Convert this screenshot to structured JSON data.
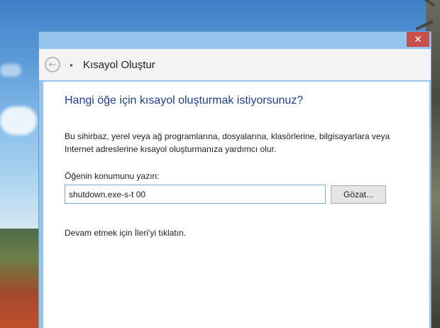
{
  "window": {
    "close_glyph": "✕",
    "nav_title": "Kısayol Oluştur",
    "back_glyph": "←",
    "wizard_glyph": "▸"
  },
  "content": {
    "heading": "Hangi öğe için kısayol oluşturmak istiyorsunuz?",
    "description": "Bu sihirbaz, yerel veya ağ programlarına, dosyalarına, klasörlerine, bilgisayarlara veya Internet adreslerine kısayol oluşturmanıza yardımcı olur.",
    "field_label": "Öğenin konumunu yazın:",
    "field_value": "shutdown.exe-s-t 00",
    "browse_label": "Gözat...",
    "instruction": "Devam etmek için İleri'yi tıklatın."
  },
  "icons": {
    "close": "close-icon",
    "back": "back-arrow-icon",
    "wizard": "shortcut-wizard-icon"
  },
  "colors": {
    "heading": "#1c3f94",
    "close_button": "#c7504a",
    "window_frame": "#95c4ec",
    "input_border": "#7aa7d6"
  }
}
